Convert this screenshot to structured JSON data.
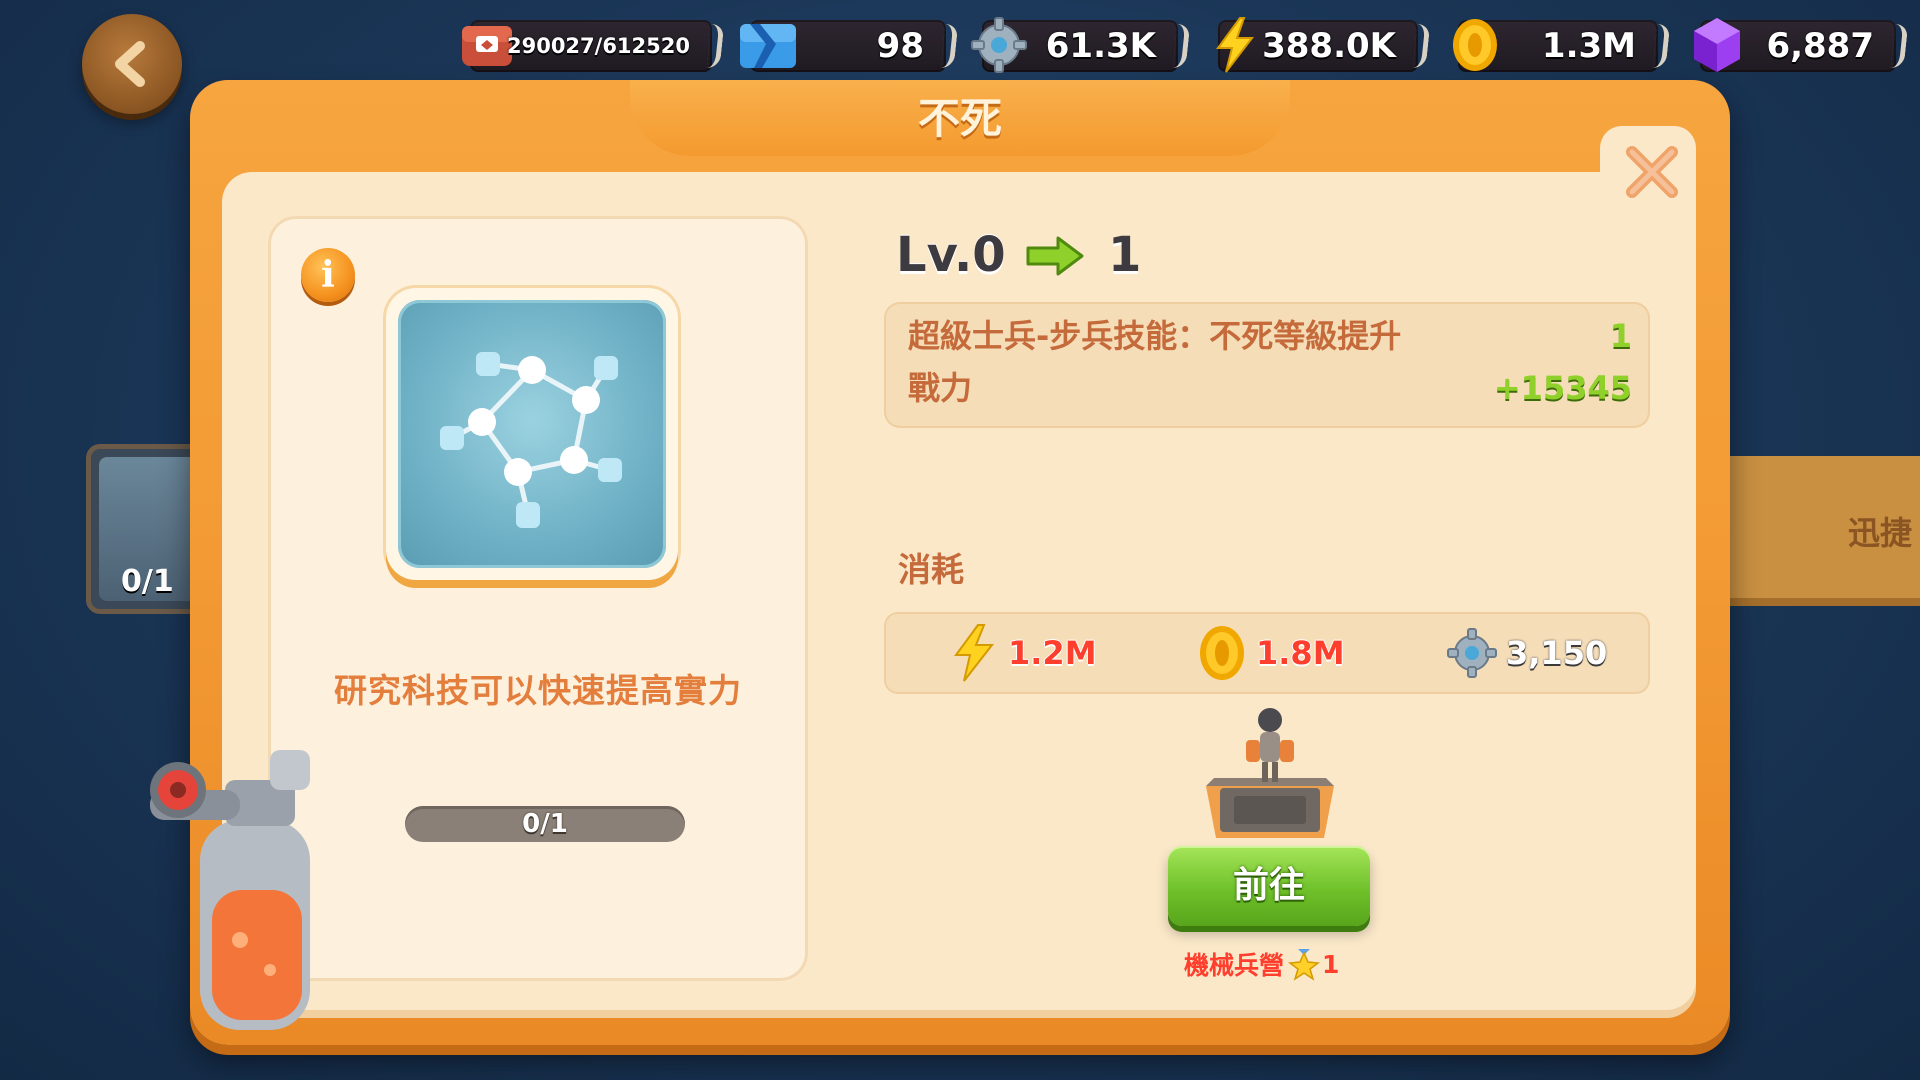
{
  "resources": [
    {
      "icon": "storage-box-icon",
      "value": "290027/612520",
      "small": true
    },
    {
      "icon": "blue-energy-icon",
      "value": "98"
    },
    {
      "icon": "gear-icon",
      "value": "61.3K"
    },
    {
      "icon": "lightning-icon",
      "value": "388.0K"
    },
    {
      "icon": "gold-coin-icon",
      "value": "1.3M"
    },
    {
      "icon": "purple-gem-icon",
      "value": "6,887"
    }
  ],
  "background": {
    "left_card_count": "0/1",
    "right_card_label": "迅捷"
  },
  "dialog": {
    "title": "不死",
    "skill_description": "研究科技可以快速提高實力",
    "progress": {
      "text": "0/1",
      "fraction": 0
    },
    "level": {
      "current": "Lv.0",
      "next": "1"
    },
    "effect": {
      "name": "超級士兵-步兵技能：不死等級提升",
      "value": "1",
      "power_label": "戰力",
      "power_value": "+15345"
    },
    "cost_label": "消耗",
    "costs": [
      {
        "icon": "lightning-icon",
        "value": "1.2M",
        "sufficient": false
      },
      {
        "icon": "gold-coin-icon",
        "value": "1.8M",
        "sufficient": false
      },
      {
        "icon": "gear-icon",
        "value": "3,150",
        "sufficient": true
      }
    ],
    "goto_button": "前往",
    "requirement": {
      "building": "機械兵營",
      "level": "1"
    }
  },
  "colors": {
    "dialog_orange": "#f39a34",
    "panel_cream": "#fbe8c9",
    "button_green": "#6fc12a",
    "insufficient_red": "#ff3f2e",
    "bonus_green": "#8fd12a"
  }
}
